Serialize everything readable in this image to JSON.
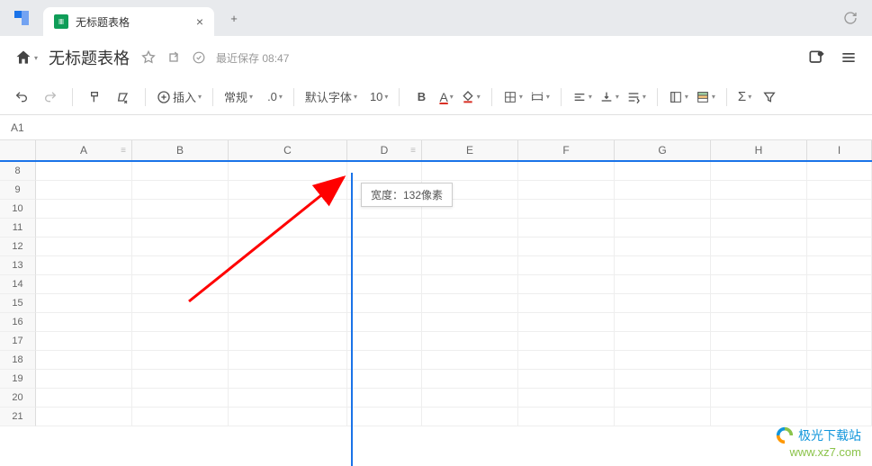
{
  "tab": {
    "title": "无标题表格",
    "close_label": "×",
    "new_tab_label": "+"
  },
  "titlebar": {
    "doc_title": "无标题表格",
    "autosave_text": "最近保存 08:47"
  },
  "toolbar": {
    "insert_label": "插入",
    "format_label": "常规",
    "decimal_label": ".0",
    "font_label": "默认字体",
    "font_size": "10",
    "bold_label": "B",
    "sum_label": "Σ"
  },
  "namebox": {
    "value": "A1"
  },
  "grid": {
    "columns": [
      "A",
      "B",
      "C",
      "D",
      "E",
      "F",
      "G",
      "H",
      "I"
    ],
    "rows": [
      8,
      9,
      10,
      11,
      12,
      13,
      14,
      15,
      16,
      17,
      18,
      19,
      20,
      21
    ]
  },
  "resize_tooltip": "宽度：132像素",
  "watermark": {
    "line1": "极光下载站",
    "line2": "www.xz7.com"
  }
}
